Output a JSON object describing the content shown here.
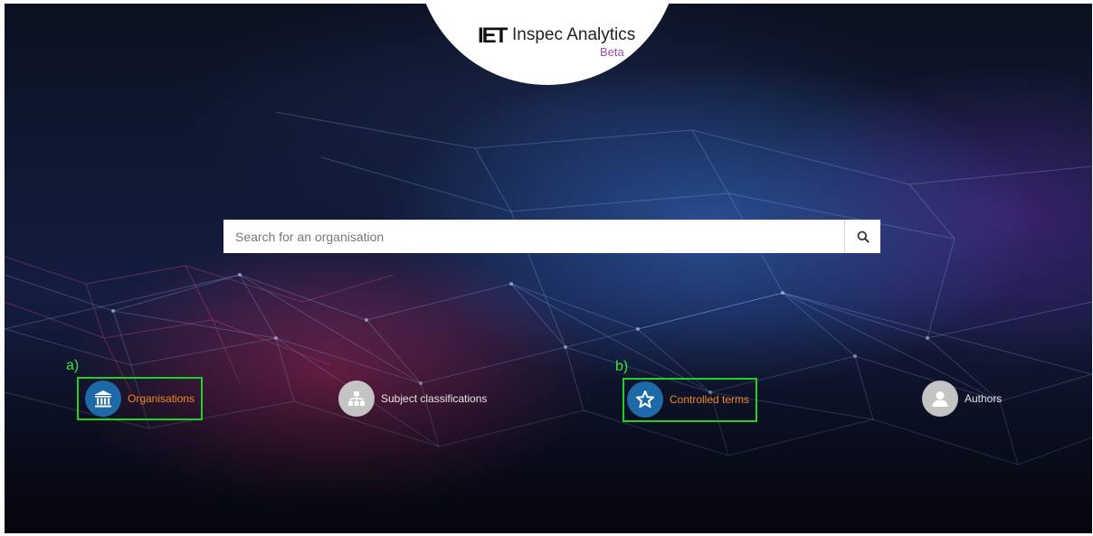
{
  "brand": {
    "mark": "IET",
    "name": "Inspec Analytics",
    "tag": "Beta"
  },
  "search": {
    "placeholder": "Search for an organisation",
    "value": "",
    "button_icon": "search-icon"
  },
  "categories": [
    {
      "label": "Organisations",
      "icon": "institution-icon",
      "state": "selected"
    },
    {
      "label": "Subject classifications",
      "icon": "hierarchy-icon",
      "state": "default"
    },
    {
      "label": "Controlled terms",
      "icon": "star-icon",
      "state": "selected"
    },
    {
      "label": "Authors",
      "icon": "person-icon",
      "state": "default"
    }
  ],
  "annotations": [
    {
      "tag": "a)",
      "target": "Organisations"
    },
    {
      "tag": "b)",
      "target": "Controlled terms"
    }
  ],
  "colors": {
    "accent_orange": "#f28a22",
    "icon_blue": "#1e6aa8",
    "icon_grey": "#c4c4c4",
    "highlight_green": "#1fd22a",
    "beta_purple": "#9b4fb5"
  }
}
